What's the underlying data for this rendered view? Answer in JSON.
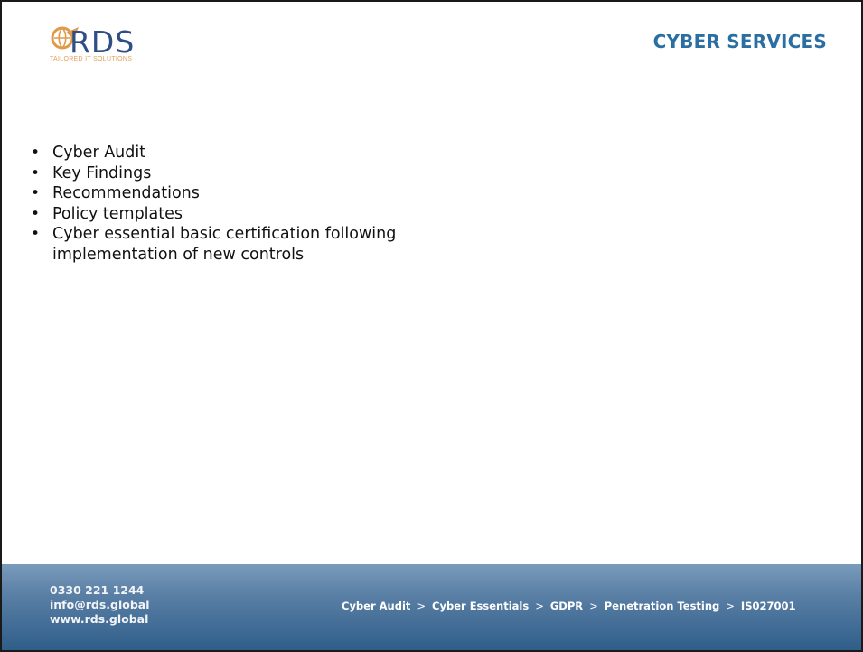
{
  "logo": {
    "wordmark": "RDS",
    "tagline": "TAILORED IT SOLUTIONS",
    "colors": {
      "wordmark": "#2f4e85",
      "mark": "#e09a4a"
    }
  },
  "title": "CYBER SERVICES",
  "bullets": [
    "Cyber Audit",
    "Key Findings",
    "Recommendations",
    "Policy templates",
    "Cyber essential basic certification following implementation of new controls"
  ],
  "footer": {
    "contact": {
      "phone": "0330 221 1244",
      "email": "info@rds.global",
      "website": "www.rds.global"
    },
    "services": [
      "Cyber Audit",
      "Cyber Essentials",
      "GDPR",
      "Penetration Testing",
      "IS027001"
    ],
    "separator": ">"
  },
  "colors": {
    "title": "#2b6fa2",
    "footer_top": "#7a9cbc",
    "footer_bottom": "#2f5e89"
  }
}
